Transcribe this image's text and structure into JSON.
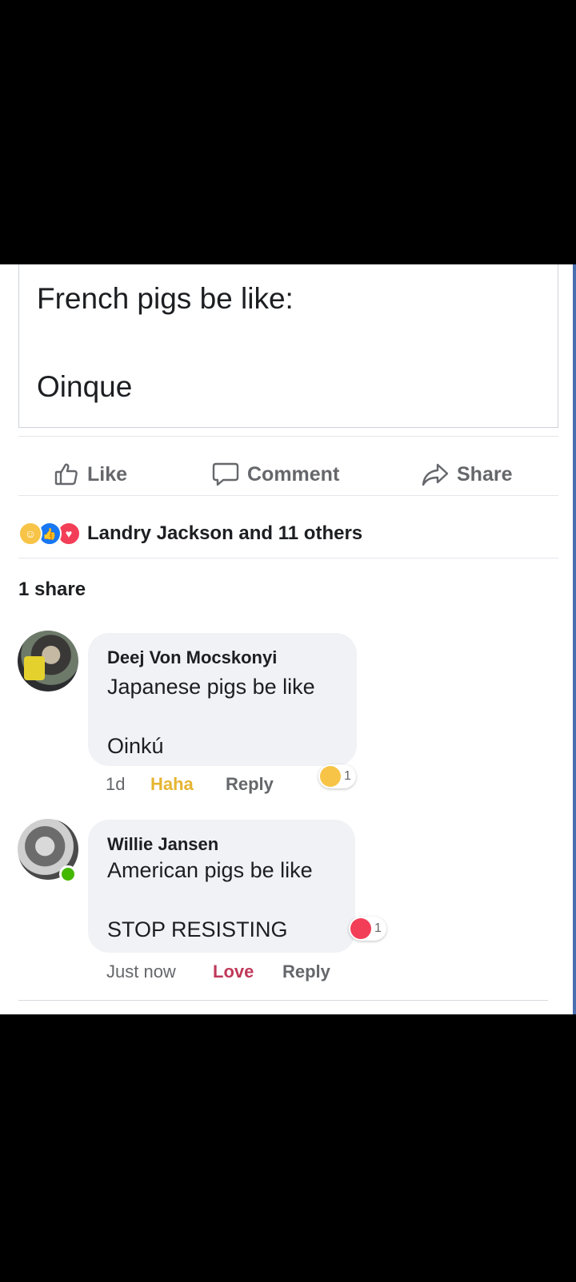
{
  "post": {
    "line1": "French pigs be like:",
    "line2": "Oinque"
  },
  "actions": {
    "like_label": "Like",
    "comment_label": "Comment",
    "share_label": "Share"
  },
  "reactions": {
    "icons": [
      "haha-icon",
      "like-icon",
      "love-icon"
    ],
    "summary": "Landry Jackson and 11 others"
  },
  "shares": {
    "count_label": "1 share"
  },
  "comments": [
    {
      "author": "Deej Von Mocskonyi",
      "line1": "Japanese pigs be like",
      "line2": "Oinkú",
      "time": "1d",
      "reaction_label": "Haha",
      "reply_label": "Reply",
      "reaction_count": "1"
    },
    {
      "author": "Willie Jansen",
      "line1": "American pigs be like",
      "line2": "STOP RESISTING",
      "time": "Just now",
      "reaction_label": "Love",
      "reply_label": "Reply",
      "reaction_count": "1"
    }
  ],
  "colors": {
    "haha": "#f7c447",
    "like": "#1877f2",
    "love": "#f33e58",
    "online": "#44b700"
  }
}
